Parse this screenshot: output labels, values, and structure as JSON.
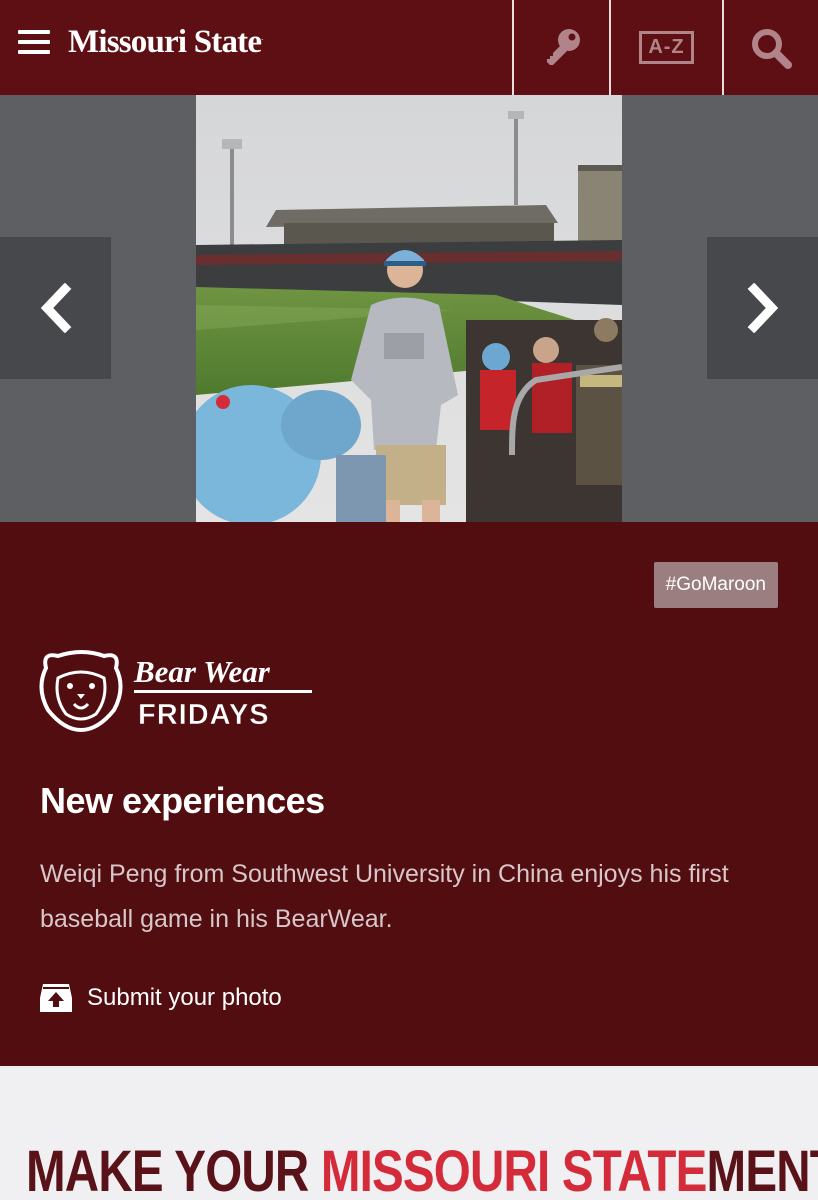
{
  "header": {
    "logo_text": "Missouri State",
    "logo_mark": ".",
    "az_label": "A-Z"
  },
  "slider": {
    "photo": "baseball-fan-photo"
  },
  "feature": {
    "tag": "#GoMaroon",
    "bearwear_logo": {
      "line1": "Bear Wear",
      "line2": "FRIDAYS"
    },
    "headline": "New experiences",
    "description": "Weiqi Peng from Southwest University in China enjoys his first baseball game in his BearWear.",
    "submit_label": "Submit your photo"
  },
  "statement": {
    "part1": "MAKE YOUR ",
    "part2": "MISSOURI STATE",
    "part3": "MENT",
    "tm": "™"
  },
  "colors": {
    "maroon": "#5e0f14",
    "feature_bg": "#520d11",
    "red_accent": "#d42b3b",
    "slider_bg": "#5d5f62"
  },
  "icons": [
    "menu-icon",
    "key-icon",
    "search-icon",
    "chevron-left-icon",
    "chevron-right-icon",
    "upload-icon",
    "bear-logo-icon"
  ]
}
